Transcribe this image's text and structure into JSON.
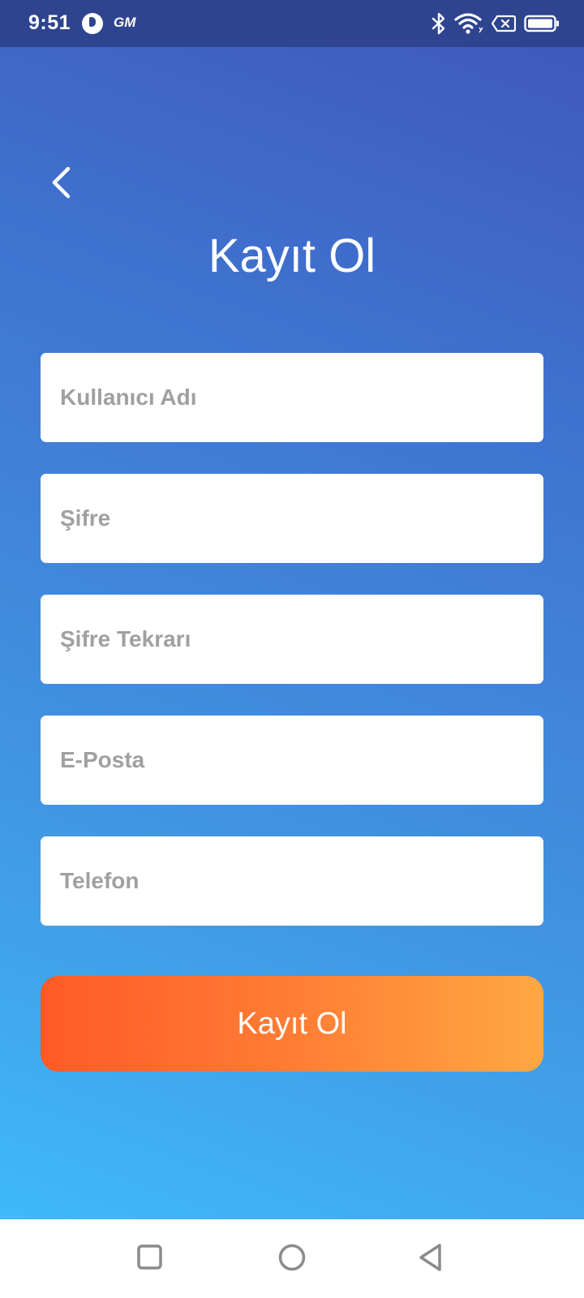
{
  "status_bar": {
    "time": "9:51",
    "app_icon": "app-notification-icon",
    "carrier_badge": "GM",
    "icons": [
      "bluetooth-icon",
      "wifi-icon",
      "no-sim-icon",
      "battery-icon"
    ]
  },
  "header": {
    "back_icon": "chevron-left-icon",
    "title": "Kayıt Ol"
  },
  "form": {
    "username_placeholder": "Kullanıcı Adı",
    "password_placeholder": "Şifre",
    "password_repeat_placeholder": "Şifre Tekrarı",
    "email_placeholder": "E-Posta",
    "phone_placeholder": "Telefon",
    "submit_label": "Kayıt Ol"
  },
  "nav_bar": {
    "items": [
      "recents-square-icon",
      "home-circle-icon",
      "back-triangle-icon"
    ]
  },
  "colors": {
    "status_bar": "#2f448f",
    "gradient_top": "#3f56bb",
    "gradient_bottom": "#3fc0fc",
    "button_start": "#ff5a26",
    "button_end": "#ffa843",
    "placeholder": "#a0a0a0"
  }
}
